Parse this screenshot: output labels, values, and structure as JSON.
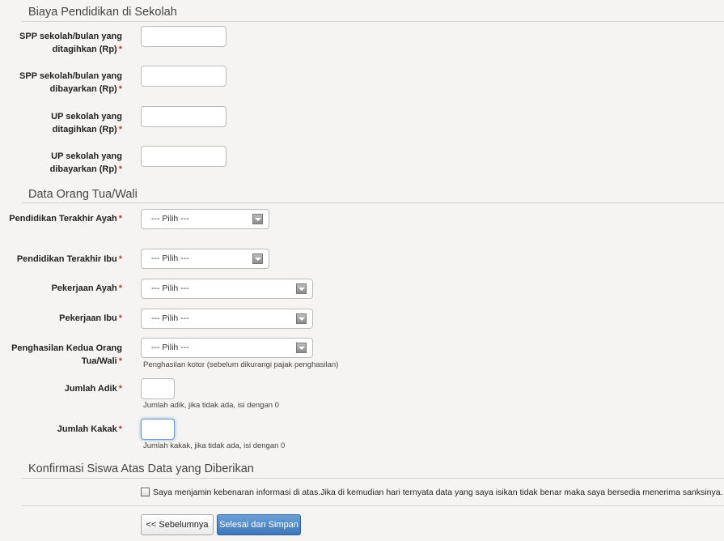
{
  "sections": {
    "biaya": "Biaya Pendidikan di Sekolah",
    "ortu": "Data Orang Tua/Wali",
    "konfirmasi": "Konfirmasi Siswa Atas Data yang Diberikan"
  },
  "required_mark": "*",
  "biaya": {
    "spp_ditagihkan": "SPP sekolah/bulan yang ditagihkan (Rp)",
    "spp_dibayarkan": "SPP sekolah/bulan yang dibayarkan (Rp)",
    "up_ditagihkan": "UP sekolah yang ditagihkan (Rp)",
    "up_dibayarkan": "UP sekolah yang dibayarkan (Rp)"
  },
  "ortu": {
    "pendidikan_ayah": "Pendidikan Terakhir Ayah",
    "pendidikan_ibu": "Pendidikan Terakhir Ibu",
    "pekerjaan_ayah": "Pekerjaan Ayah",
    "pekerjaan_ibu": "Pekerjaan Ibu",
    "penghasilan": "Penghasilan Kedua Orang Tua/Wali",
    "penghasilan_help": "Penghasilan kotor (sebelum dikurangi pajak penghasilan)",
    "jumlah_adik": "Jumlah Adik",
    "jumlah_adik_help": "Jumlah adik, jika tidak ada, isi dengan 0",
    "jumlah_kakak": "Jumlah Kakak",
    "jumlah_kakak_help": "Jumlah kakak, jika tidak ada, isi dengan 0",
    "select_placeholder": "--- Pilih ---"
  },
  "konfirmasi": {
    "text": "Saya menjamin kebenaran informasi di atas.Jika di kemudian hari ternyata data yang saya isikan tidak benar maka saya bersedia menerima sanksinya."
  },
  "buttons": {
    "prev": "<< Sebelumnya",
    "save": "Selesai dan Simpan"
  }
}
